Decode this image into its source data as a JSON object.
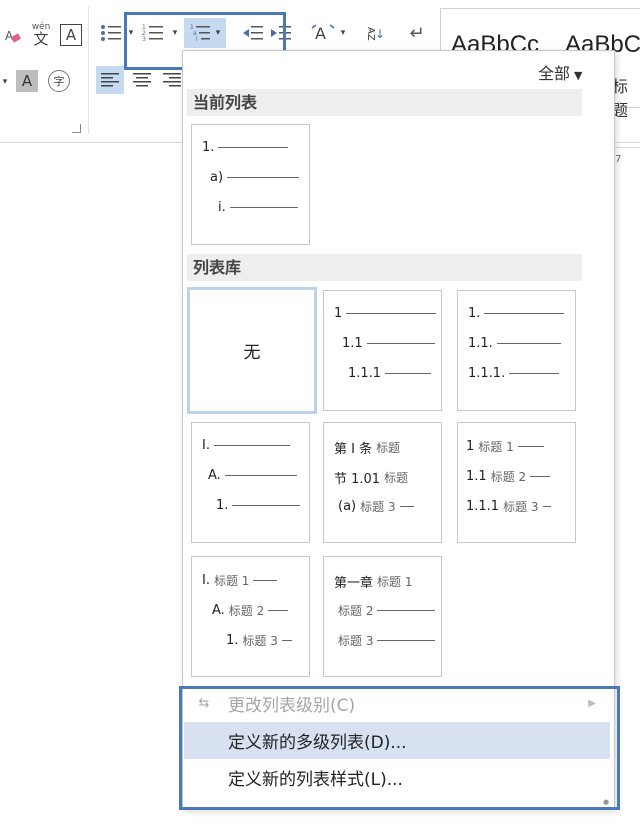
{
  "ribbon": {
    "ruby_label": "wén",
    "ruby_char": "文",
    "font_box_char": "A",
    "shaded_char": "A",
    "circled_char": "字",
    "sort_label": "AZ",
    "styles": [
      "AaBbCc",
      "AaBbC"
    ],
    "quick_style_label": "标题",
    "ruler_mark": "7"
  },
  "panel": {
    "filter_label": "全部",
    "current_list_header": "当前列表",
    "library_header": "列表库",
    "current_list": {
      "lines": [
        "1.",
        "a)",
        "i."
      ]
    },
    "library": [
      {
        "none_label": "无"
      },
      {
        "lines": [
          "1",
          "1.1",
          "1.1.1"
        ]
      },
      {
        "lines": [
          "1.",
          "1.1.",
          "1.1.1."
        ]
      },
      {
        "lines": [
          "I.",
          "A.",
          "1."
        ]
      },
      {
        "lines": [
          {
            "text": "第 I 条",
            "label": "标题"
          },
          {
            "text": "节 1.01",
            "label": "标题"
          },
          {
            "text": "(a)",
            "label": "标题 3"
          }
        ]
      },
      {
        "lines": [
          {
            "text": "1",
            "label": "标题 1"
          },
          {
            "text": "1.1",
            "label": "标题 2"
          },
          {
            "text": "1.1.1",
            "label": "标题 3"
          }
        ]
      },
      {
        "lines": [
          {
            "text": "I.",
            "label": "标题 1"
          },
          {
            "text": "A.",
            "label": "标题 2"
          },
          {
            "text": "1.",
            "label": "标题 3"
          }
        ]
      },
      {
        "lines": [
          {
            "text": "第一章",
            "label": "标题 1"
          },
          {
            "text": "",
            "label": "标题 2"
          },
          {
            "text": "",
            "label": "标题 3"
          }
        ]
      }
    ]
  },
  "menu": {
    "change_level": "更改列表级别(C)",
    "define_multilevel": "定义新的多级列表(D)...",
    "define_style": "定义新的列表样式(L)..."
  },
  "colors": {
    "highlight": "#4a79b9",
    "selected_bg": "#c5d9f1",
    "hover_bg": "#d7e1f2"
  }
}
